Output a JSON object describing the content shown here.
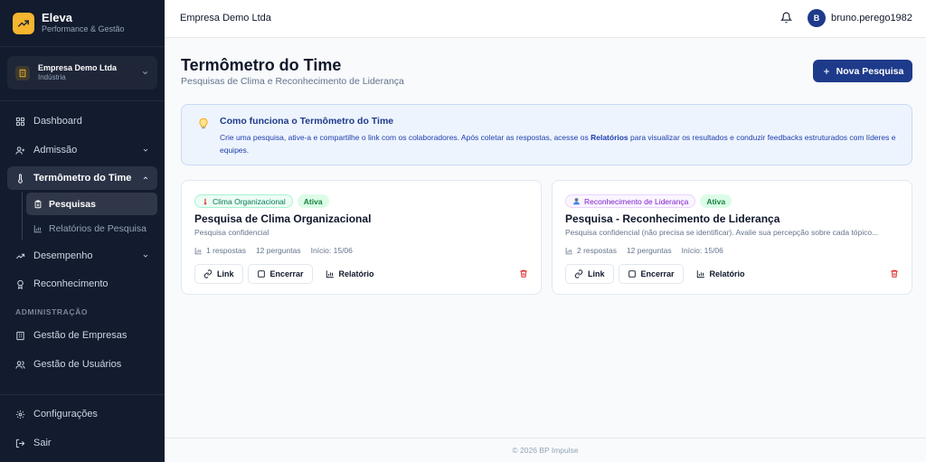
{
  "brand": {
    "name": "Eleva",
    "subtitle": "Performance & Gestão",
    "accent": "#f5b52e"
  },
  "company_selector": {
    "name": "Empresa Demo Ltda",
    "sector": "Indústria"
  },
  "sidebar": {
    "items": [
      {
        "label": "Dashboard",
        "icon": "grid-icon"
      },
      {
        "label": "Admissão",
        "icon": "user-plus-icon"
      },
      {
        "label": "Termômetro do Time",
        "icon": "thermometer-icon",
        "expanded": true
      },
      {
        "label": "Desempenho",
        "icon": "trending-up-icon"
      },
      {
        "label": "Reconhecimento",
        "icon": "award-icon"
      }
    ],
    "subitems": [
      {
        "label": "Pesquisas",
        "icon": "clipboard-icon",
        "active": true
      },
      {
        "label": "Relatórios de Pesquisa",
        "icon": "bar-chart-icon"
      }
    ],
    "section_admin": "ADMINISTRAÇÃO",
    "admin_items": [
      {
        "label": "Gestão de Empresas",
        "icon": "building-icon"
      },
      {
        "label": "Gestão de Usuários",
        "icon": "users-icon"
      }
    ],
    "bottom_items": [
      {
        "label": "Configurações",
        "icon": "gear-icon"
      },
      {
        "label": "Sair",
        "icon": "logout-icon"
      }
    ]
  },
  "header": {
    "title": "Empresa Demo Ltda",
    "avatar_initial": "B",
    "username": "bruno.perego1982"
  },
  "page": {
    "title": "Termômetro do Time",
    "subtitle": "Pesquisas de Clima e Reconhecimento de Liderança",
    "new_button": "Nova Pesquisa"
  },
  "info": {
    "title": "Como funciona o Termômetro do Time",
    "text_before": "Crie uma pesquisa, ative-a e compartilhe o link com os colaboradores. Após coletar as respostas, acesse os ",
    "text_bold": "Relatórios",
    "text_after": " para visualizar os resultados e conduzir feedbacks estruturados com líderes e equipes."
  },
  "cards": [
    {
      "type_label": "Clima Organizacional",
      "status": "Ativa",
      "title": "Pesquisa de Clima Organizacional",
      "description": "Pesquisa confidencial",
      "responses": "1 respostas",
      "questions": "12 perguntas",
      "start": "Início: 15/06",
      "actions": {
        "link": "Link",
        "close": "Encerrar",
        "report": "Relatório"
      }
    },
    {
      "type_label": "Reconhecimento de Liderança",
      "status": "Ativa",
      "title": "Pesquisa - Reconhecimento de Liderança",
      "description": "Pesquisa confidencial (não precisa se identificar). Avalie sua percepção sobre cada tópico...",
      "responses": "2 respostas",
      "questions": "12 perguntas",
      "start": "Início: 15/06",
      "actions": {
        "link": "Link",
        "close": "Encerrar",
        "report": "Relatório"
      }
    }
  ],
  "footer": {
    "text": "© 2026 BP Impulse"
  }
}
